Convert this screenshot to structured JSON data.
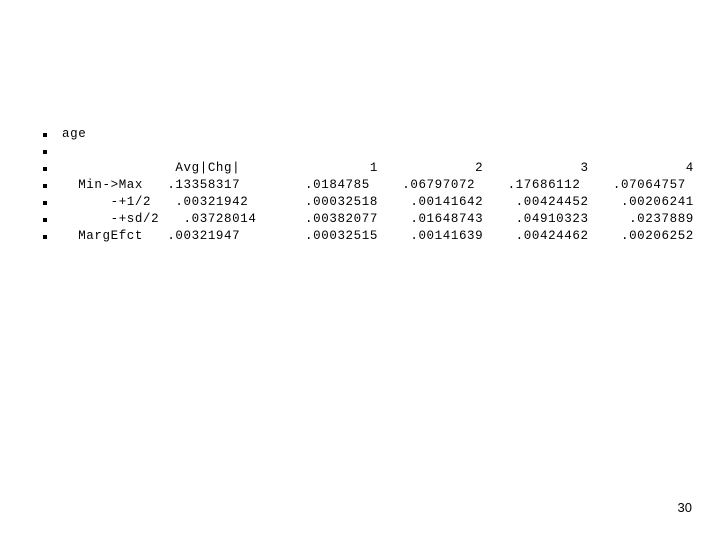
{
  "slide": {
    "page_number": "30",
    "background_color": "#ffffff",
    "text_color": "#000000",
    "bullet_glyph": "square-bullet"
  },
  "output": {
    "variable_label": "age",
    "blank_label": "",
    "header": {
      "row_label": "",
      "avg_chg_label": "Avg|Chg|",
      "columns": [
        "1",
        "2",
        "3",
        "4"
      ]
    },
    "rows": [
      {
        "label": "Min->Max",
        "avg_chg": ".13358317",
        "values": [
          ".0184785",
          ".06797072",
          ".17686112",
          ".07064757"
        ]
      },
      {
        "label": "-+1/2",
        "avg_chg": ".00321942",
        "values": [
          ".00032518",
          ".00141642",
          ".00424452",
          ".00206241"
        ]
      },
      {
        "label": "-+sd/2",
        "avg_chg": ".03728014",
        "values": [
          ".00382077",
          ".01648743",
          ".04910323",
          ".0237889"
        ]
      },
      {
        "label": "MargEfct",
        "avg_chg": ".00321947",
        "values": [
          ".00032515",
          ".00141639",
          ".00424462",
          ".00206252"
        ]
      }
    ],
    "lines": [
      "  age",
      "",
      "              Avg|Chg|                1            2            3            4",
      "  Min->Max   .13358317        .0184785    .06797072    .17686112    .07064757",
      "      -+1/2   .00321942       .00032518    .00141642    .00424452    .00206241",
      "      -+sd/2   .03728014      .00382077    .01648743    .04910323     .0237889",
      "  MargEfct   .00321947        .00032515    .00141639    .00424462    .00206252"
    ]
  }
}
